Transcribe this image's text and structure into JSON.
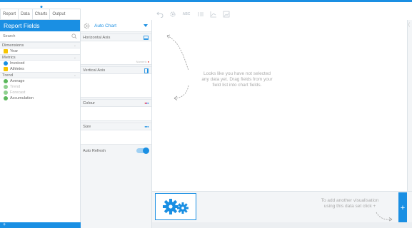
{
  "menu": {
    "items": [
      {
        "label": "Report"
      },
      {
        "label": "Data"
      },
      {
        "label": "Charts"
      },
      {
        "label": "Output"
      }
    ],
    "active_index": 2
  },
  "toolbar": {
    "icons": [
      "undo-icon",
      "settings-icon",
      "text-icon",
      "list-icon",
      "axis-chart-icon",
      "image-icon"
    ],
    "text_icon_label": "ABC"
  },
  "report_fields": {
    "title": "Report Fields",
    "search_placeholder": "Search",
    "sections": [
      {
        "name": "Dimensions",
        "fields": [
          {
            "label": "Year",
            "color": "#f6c400",
            "shape": "square",
            "dim": false
          }
        ]
      },
      {
        "name": "Metrics",
        "fields": [
          {
            "label": "Invoiced",
            "color": "#1a8fe3",
            "shape": "circle",
            "dim": false
          },
          {
            "label": "Athletes",
            "color": "#f6c400",
            "shape": "square",
            "dim": false
          }
        ]
      },
      {
        "name": "Trend",
        "fields": [
          {
            "label": "Average",
            "color": "#5cb85c",
            "shape": "circle",
            "dim": false
          },
          {
            "label": "Trend",
            "color": "#5cb85c",
            "shape": "circle",
            "dim": true
          },
          {
            "label": "Forecast",
            "color": "#5cb85c",
            "shape": "circle",
            "dim": true
          },
          {
            "label": "Accumulation",
            "color": "#5cb85c",
            "shape": "circle",
            "dim": false
          }
        ]
      }
    ],
    "add_label": "+"
  },
  "chart_config": {
    "chart_type": "Auto Chart",
    "horizontal_axis": {
      "label": "Horizontal Axis",
      "hint": "Numeric"
    },
    "vertical_axis": {
      "label": "Vertical Axis"
    },
    "colour": {
      "label": "Colour"
    },
    "size": {
      "label": "Size"
    },
    "auto_refresh": {
      "label": "Auto Refresh",
      "on": true
    }
  },
  "canvas": {
    "placeholder_line1": "Looks like you have not selected",
    "placeholder_line2": "any data yet. Drag fields from your",
    "placeholder_line3": "field list into chart fields."
  },
  "bottom": {
    "hint_line1": "To add another visualisation",
    "hint_line2": "using this data set click +",
    "add_button_label": "+"
  },
  "colors": {
    "accent": "#1a8fe3",
    "yellow": "#f6c400",
    "green": "#5cb85c",
    "red": "#e53935"
  }
}
